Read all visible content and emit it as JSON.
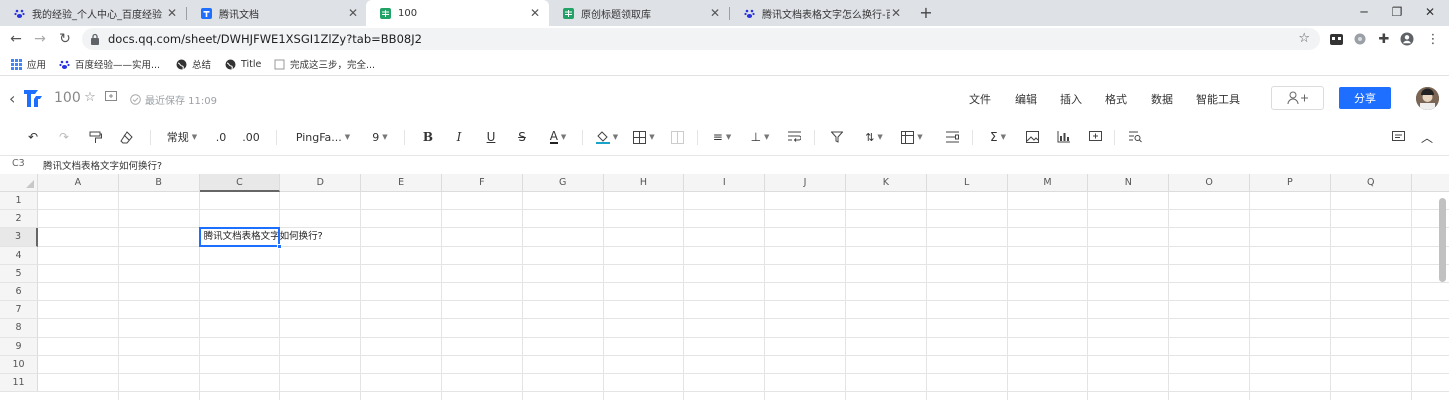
{
  "browser": {
    "tabs": [
      {
        "title": "我的经验_个人中心_百度经验",
        "active": false,
        "favicon": "baidu-paw-icon"
      },
      {
        "title": "腾讯文档",
        "active": false,
        "favicon": "tencent-docs-icon"
      },
      {
        "title": "100",
        "active": true,
        "favicon": "sheet-icon"
      },
      {
        "title": "原创标题领取库",
        "active": false,
        "favicon": "sheet-icon"
      },
      {
        "title": "腾讯文档表格文字怎么换行-百度",
        "active": false,
        "favicon": "baidu-paw-icon"
      }
    ],
    "url": "docs.qq.com/sheet/DWHJFWE1XSGI1ZlZy?tab=BB08J2",
    "bookmarks": [
      {
        "label": "应用",
        "icon": "apps-grid-icon"
      },
      {
        "label": "百度经验——实用...",
        "icon": "baidu-paw-icon"
      },
      {
        "label": "总结",
        "icon": "globe-icon"
      },
      {
        "label": "Title",
        "icon": "globe-icon"
      },
      {
        "label": "完成这三步，完全...",
        "icon": "page-icon"
      }
    ]
  },
  "doc": {
    "name": "100",
    "save_status": "最近保存 11:09",
    "menu": [
      "文件",
      "编辑",
      "插入",
      "格式",
      "数据",
      "智能工具"
    ],
    "share_label": "分享"
  },
  "toolbar": {
    "number_format": "常规",
    "decimal_decrease": ".0",
    "decimal_increase": ".00",
    "font_family": "PingFa...",
    "font_size": "9"
  },
  "formula_bar": {
    "cell_ref": "C3",
    "content": "腾讯文档表格文字如何换行?"
  },
  "sheet": {
    "columns": [
      "A",
      "B",
      "C",
      "D",
      "E",
      "F",
      "G",
      "H",
      "I",
      "J",
      "K",
      "L",
      "M",
      "N",
      "O",
      "P",
      "Q"
    ],
    "rows": [
      "1",
      "2",
      "3",
      "4",
      "5",
      "6",
      "7",
      "8",
      "9",
      "10",
      "11"
    ],
    "selected_cell": "C3",
    "cell_c3": "腾讯文档表格文字如何换行?"
  },
  "colors": {
    "accent": "#1e6fff",
    "tabstrip": "#dee1e6",
    "sheet_green": "#21a366",
    "baidu_blue": "#2932e1"
  }
}
